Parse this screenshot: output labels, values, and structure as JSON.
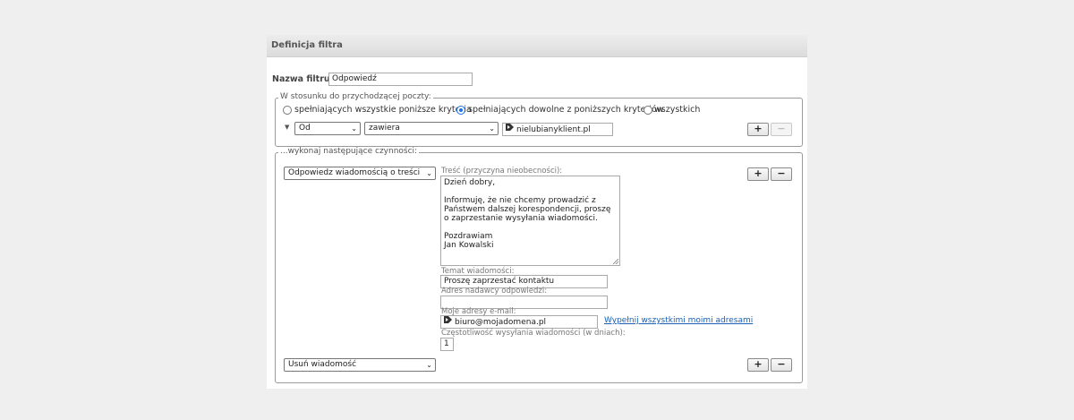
{
  "panel": {
    "title": "Definicja filtra"
  },
  "filter_name": {
    "label": "Nazwa filtru:",
    "value": "Odpowiedź"
  },
  "criteria": {
    "legend": "W stosunku do przychodzącej poczty:",
    "options": [
      {
        "label": "spełniających wszystkie poniższe kryteria",
        "selected": false
      },
      {
        "label": "spełniających dowolne z poniższych kryteriów",
        "selected": true
      },
      {
        "label": "wszystkich",
        "selected": false
      }
    ],
    "rule": {
      "field": "Od",
      "operator": "zawiera",
      "value": "nielubianyklient.pl"
    },
    "add_button": "+",
    "remove_button": "−"
  },
  "actions": {
    "legend": "...wykonaj następujące czynności:",
    "action1": {
      "type": "Odpowiedz wiadomością o treści",
      "body_label": "Treść (przyczyna nieobecności):",
      "body_text": "Dzień dobry,\n\nInformuję, że nie chcemy prowadzić z Państwem dalszej korespondencji, proszę o zaprzestanie wysyłania wiadomości.\n\nPozdrawiam\nJan Kowalski",
      "subject_label": "Temat wiadomości:",
      "subject_value": "Proszę zaprzestać kontaktu",
      "sender_label": "Adres nadawcy odpowiedzi:",
      "sender_value": "",
      "my_addresses_label": "Moje adresy e-mail:",
      "my_addresses_value": "biuro@mojadomena.pl",
      "fill_all_link": "Wypełnij wszystkimi moimi adresami",
      "frequency_label": "Częstotliwość wysyłania wiadomości (w dniach):",
      "frequency_value": "1"
    },
    "action2": {
      "type": "Usuń wiadomość"
    },
    "add_button": "+",
    "remove_button": "−"
  },
  "icons": {
    "address": "address-tag-icon",
    "chevron": "chevron-down-icon",
    "expand": "triangle-down-icon"
  }
}
